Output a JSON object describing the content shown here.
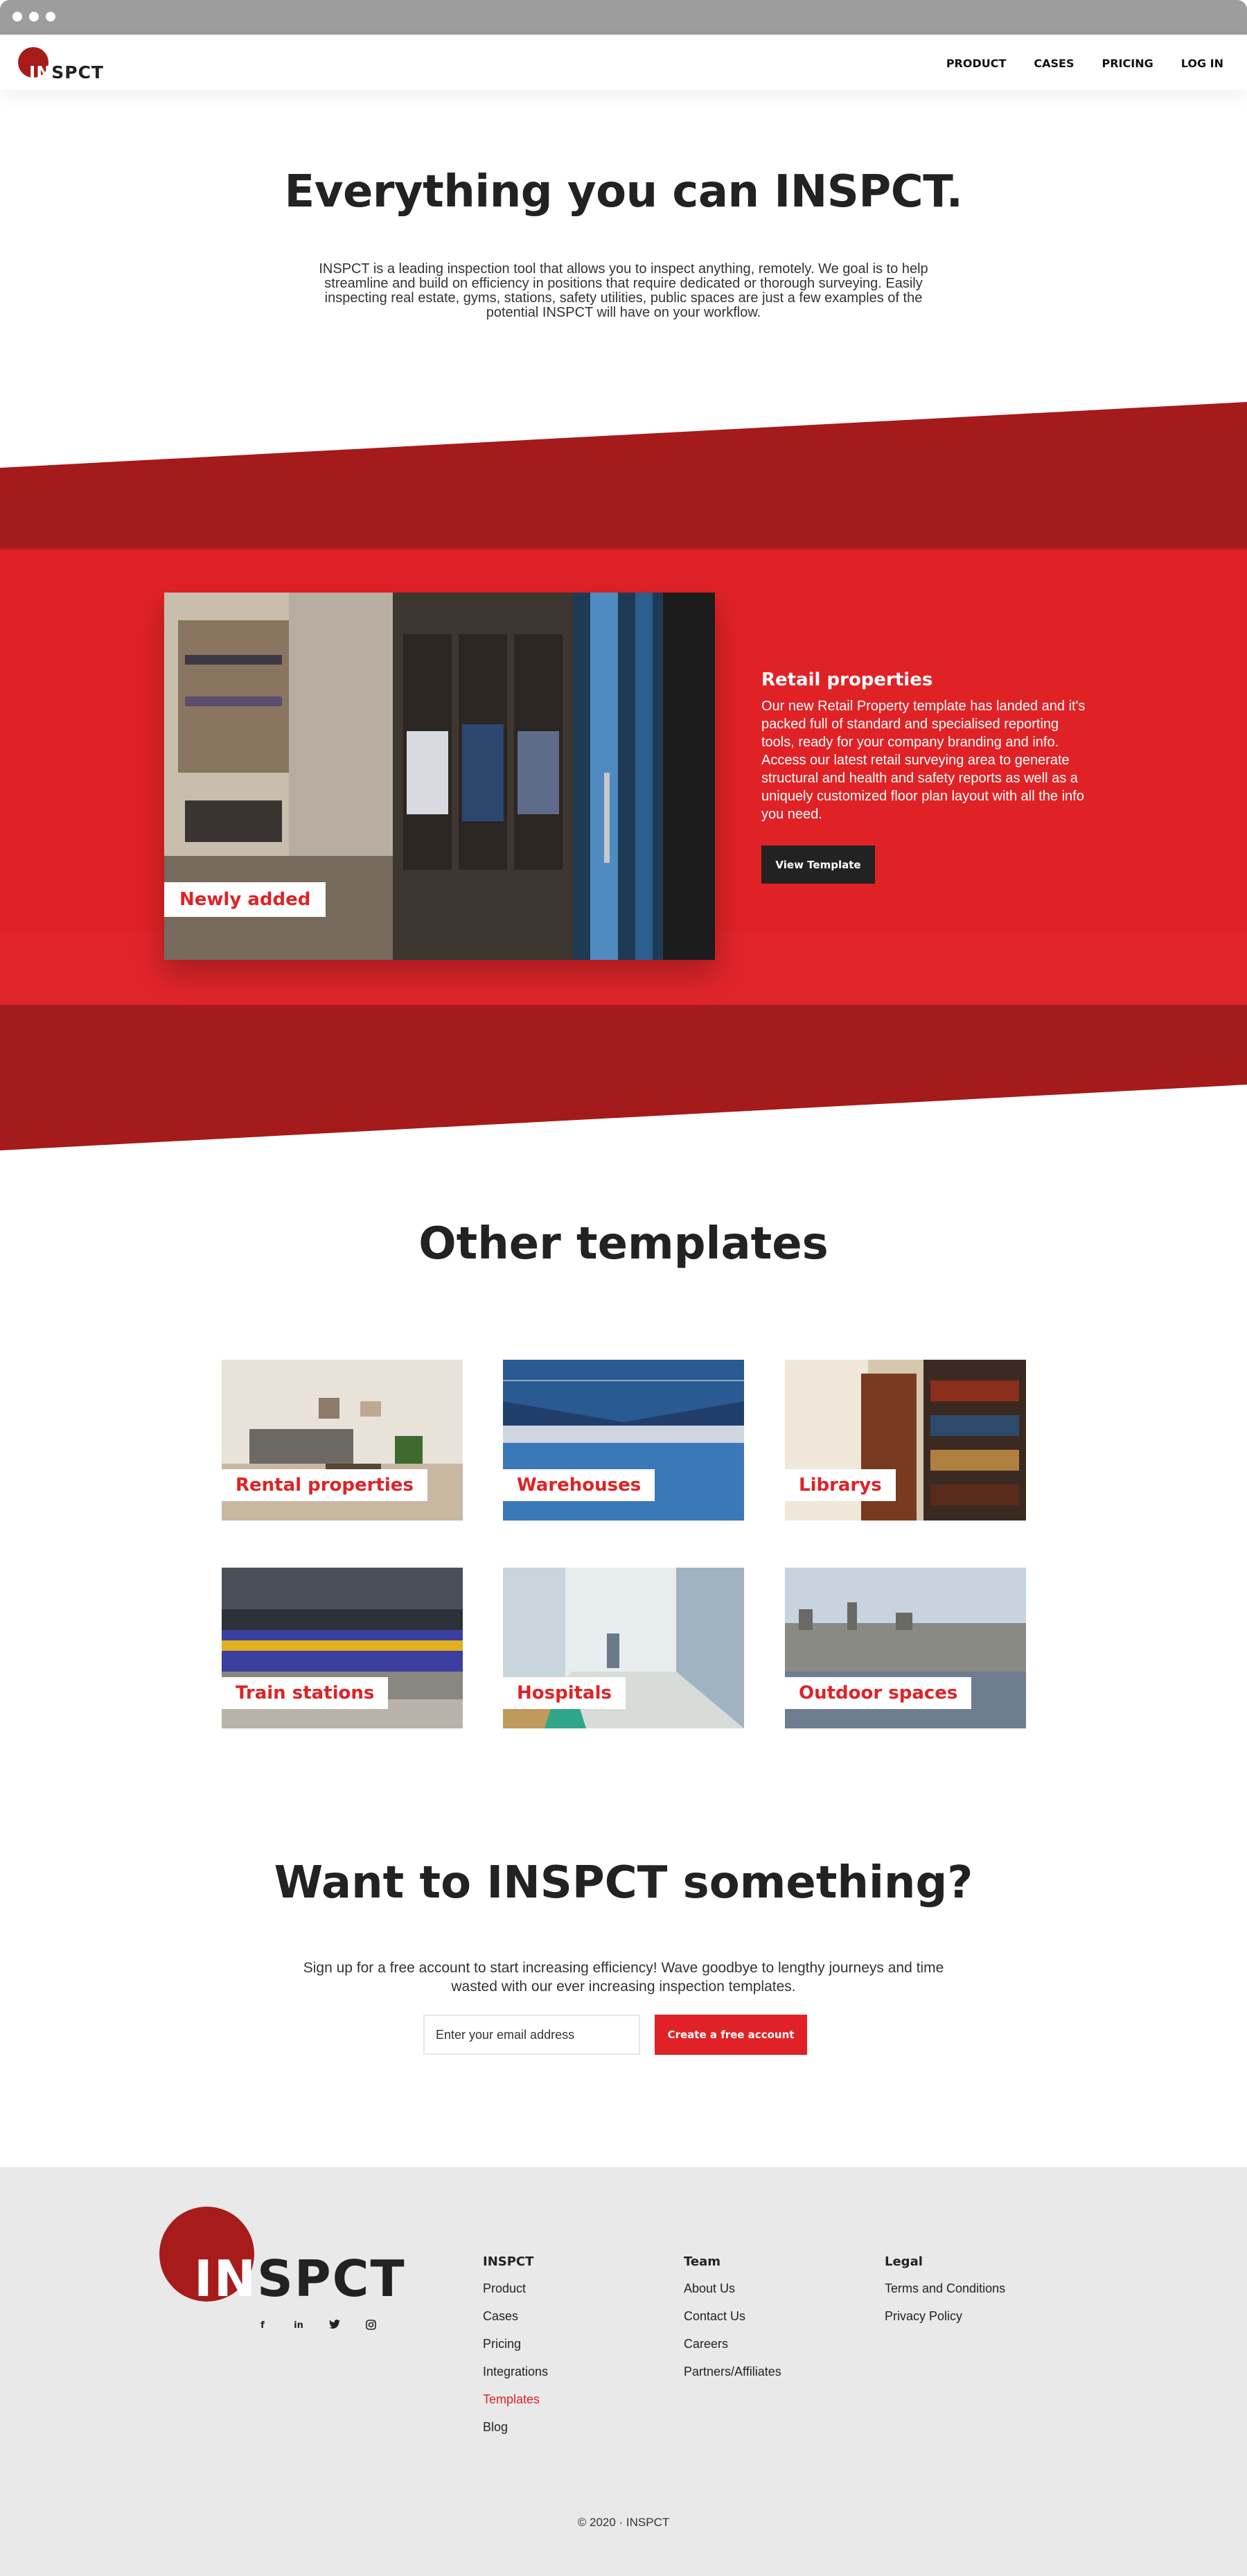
{
  "nav": {
    "logo_in": "IN",
    "logo_rest": "SPCT",
    "links": [
      "PRODUCT",
      "CASES",
      "PRICING",
      "LOG IN"
    ]
  },
  "hero": {
    "title": "Everything you can INSPCT.",
    "text": "INSPCT is a leading inspection tool that allows you to inspect anything, remotely. We goal is to help streamline and build on efficiency in positions that require dedicated or thorough surveying. Easily inspecting real estate, gyms, stations, safety utilities, public spaces are just a few examples of the potential INSPCT will have on your workflow."
  },
  "feature": {
    "tag": "Newly added",
    "title": "Retail properties",
    "text": "Our new Retail Property template has landed and it's packed full of standard and specialised reporting tools, ready for your company branding and info. Access our latest retail surveying area to generate structural and health and safety reports as well as a uniquely customized floor plan layout with all the info you need.",
    "button": "View Template"
  },
  "templates": {
    "title": "Other templates",
    "items": [
      {
        "label": "Rental properties"
      },
      {
        "label": "Warehouses"
      },
      {
        "label": "Librarys"
      },
      {
        "label": "Train stations"
      },
      {
        "label": "Hospitals"
      },
      {
        "label": "Outdoor spaces"
      }
    ]
  },
  "cta": {
    "title": "Want to INSPCT something?",
    "text": "Sign up for a free account to start increasing efficiency! Wave goodbye to lengthy journeys and time wasted with our ever increasing inspection templates.",
    "placeholder": "Enter your email address",
    "button": "Create a free account"
  },
  "footer": {
    "logo_in": "IN",
    "logo_rest": "SPCT",
    "socials": [
      "facebook-icon",
      "linkedin-icon",
      "twitter-icon",
      "instagram-icon"
    ],
    "columns": [
      {
        "title": "INSPCT",
        "links": [
          "Product",
          "Cases",
          "Pricing",
          "Integrations",
          "Templates",
          "Blog"
        ]
      },
      {
        "title": "Team",
        "links": [
          "About Us",
          "Contact Us",
          "Careers",
          "Partners/Affiliates"
        ]
      },
      {
        "title": "Legal",
        "links": [
          "Terms and Conditions",
          "Privacy Policy"
        ]
      }
    ],
    "copyright": "© 2020 · INSPCT"
  },
  "colors": {
    "accent": "#e02226",
    "dark_red": "#a81b1b",
    "dark": "#222222",
    "footer_bg": "#e9e9e9"
  }
}
